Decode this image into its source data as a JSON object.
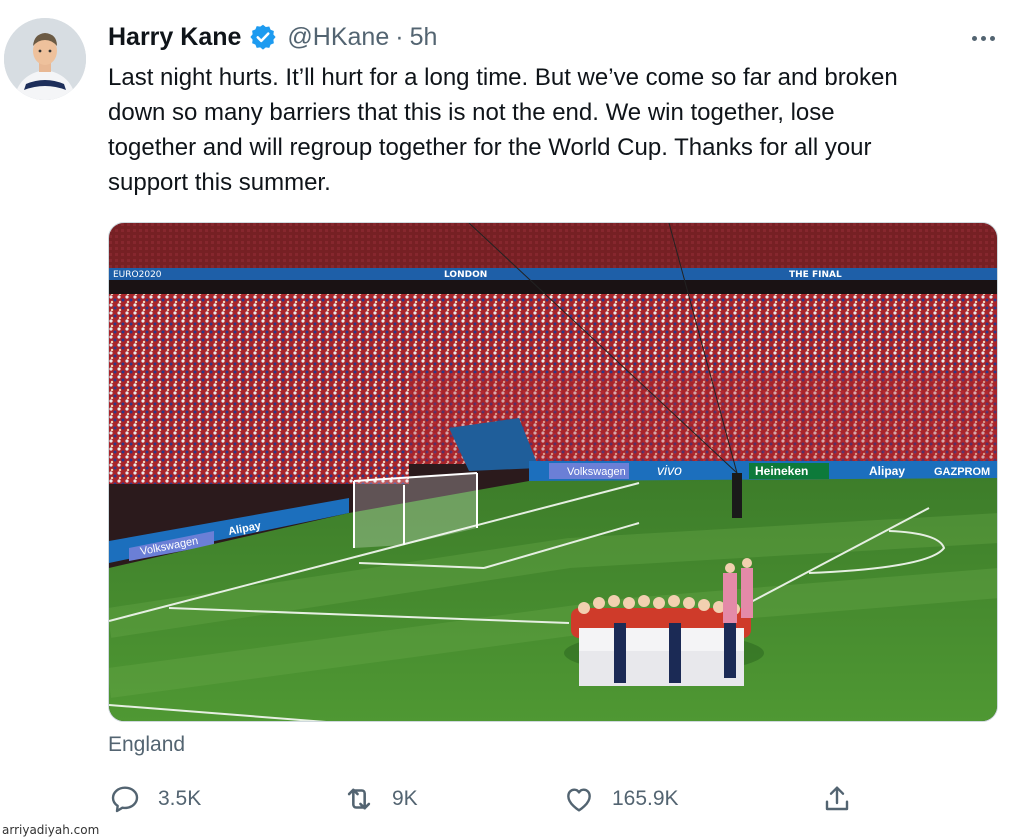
{
  "tweet": {
    "author": {
      "display_name": "Harry Kane",
      "handle": "@HKane",
      "verified": true,
      "avatar": "player-avatar"
    },
    "separator": "·",
    "time_ago": "5h",
    "text": "Last night hurts. It’ll hurt for a long time. But we’ve come so far and broken\ndown so many barriers that this is not the end. We win together, lose\ntogether and will regroup together for the World Cup. Thanks for all your\nsupport this summer.",
    "media": {
      "banner_left": "EURO2020",
      "banner_center": "LONDON",
      "banner_right": "THE FINAL",
      "board_volkswagen": "Volkswagen",
      "board_alipay": "Alipay",
      "board_heineken": "Heineken",
      "board_vivo": "vivo",
      "board_gazprom": "GAZPROM"
    },
    "location": "England",
    "actions": {
      "reply_count": "3.5K",
      "retweet_count": "9K",
      "like_count": "165.9K"
    }
  },
  "watermark": "arriyadiyah.com",
  "colors": {
    "verified_blue": "#1d9bf0",
    "text_secondary": "#536471",
    "pitch_green": "#3f8a2a",
    "seat_red": "#b3262b"
  }
}
